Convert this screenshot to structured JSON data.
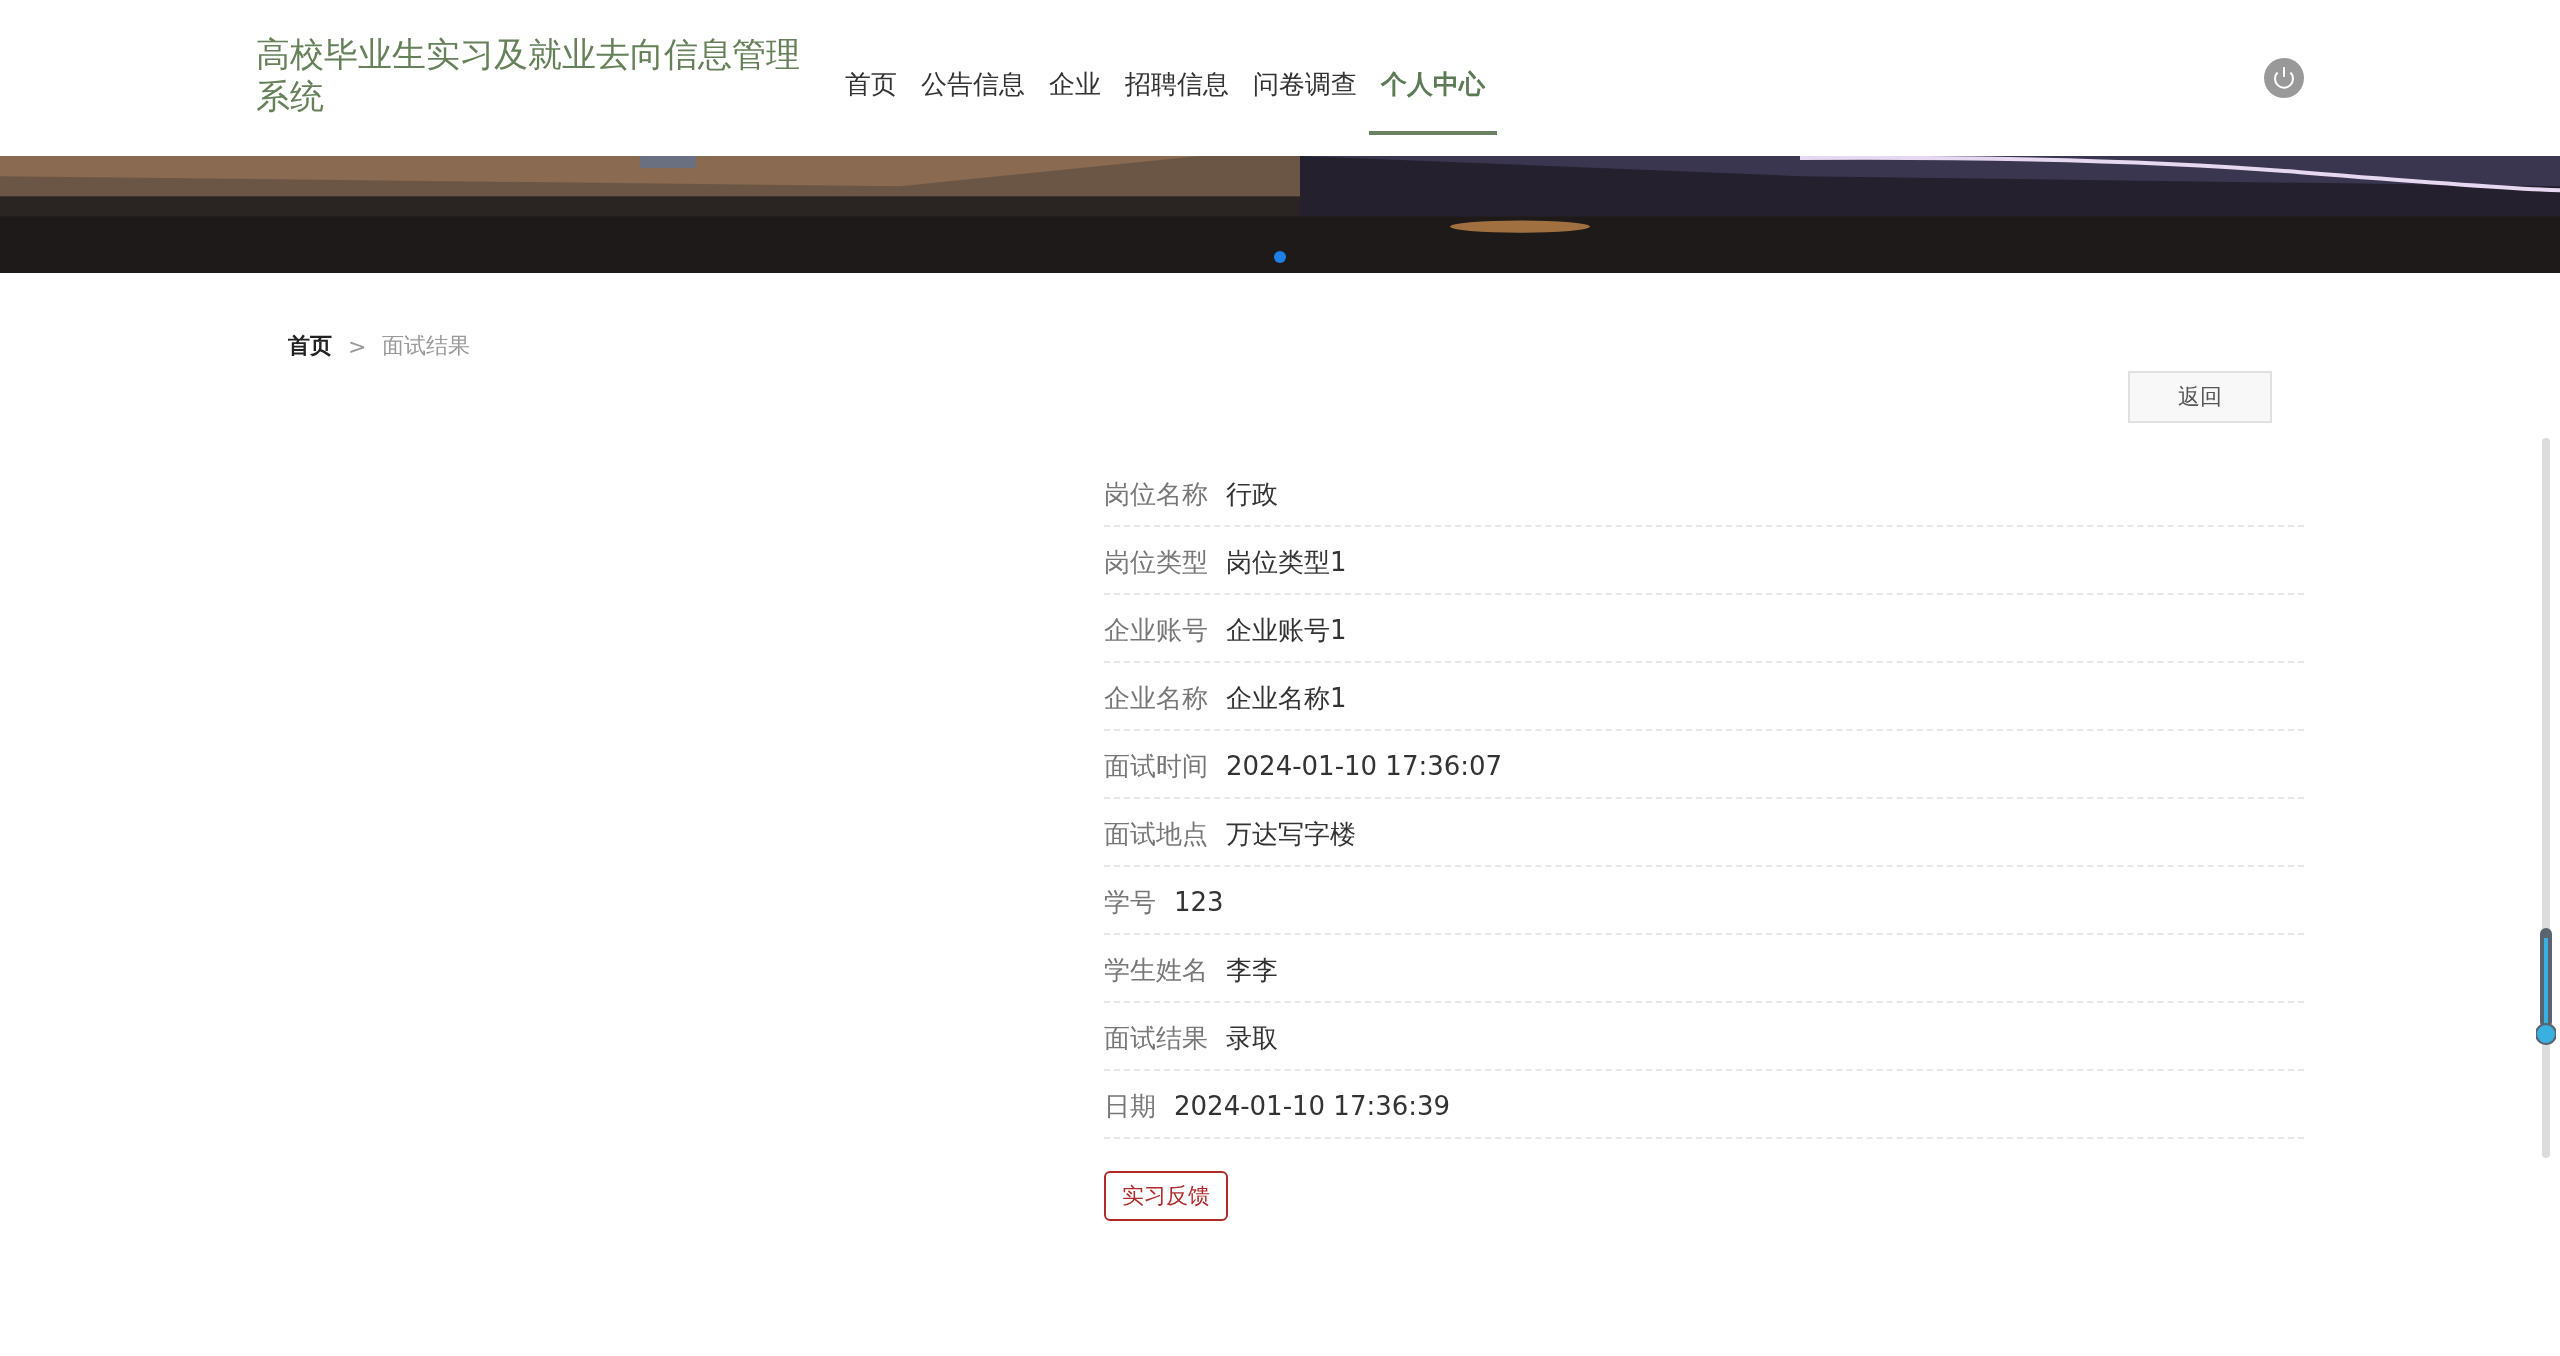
{
  "site_title": "高校毕业生实习及就业去向信息管理系统",
  "nav": [
    {
      "label": "首页",
      "selected": false
    },
    {
      "label": "公告信息",
      "selected": false
    },
    {
      "label": "企业",
      "selected": false
    },
    {
      "label": "招聘信息",
      "selected": false
    },
    {
      "label": "问卷调查",
      "selected": false
    },
    {
      "label": "个人中心",
      "selected": true
    }
  ],
  "banner": {
    "kind": "picture",
    "dots": [
      {
        "selected": true
      }
    ]
  },
  "breadcrumb": [
    "首页",
    "面试结果"
  ],
  "breadcrumb_separator": ">",
  "back_button": "返回",
  "fields": [
    {
      "label": "岗位名称",
      "value": "行政"
    },
    {
      "label": "岗位类型",
      "value": "岗位类型1"
    },
    {
      "label": "企业账号",
      "value": "企业账号1"
    },
    {
      "label": "企业名称",
      "value": "企业名称1"
    },
    {
      "label": "面试时间",
      "value": "2024-01-10 17:36:07"
    },
    {
      "label": "面试地点",
      "value": "万达写字楼"
    },
    {
      "label": "学号",
      "value": "123"
    },
    {
      "label": "学生姓名",
      "value": "李李"
    },
    {
      "label": "面试结果",
      "value": "录取"
    },
    {
      "label": "日期",
      "value": "2024-01-10 17:36:39"
    }
  ],
  "action_button": "实习反馈"
}
